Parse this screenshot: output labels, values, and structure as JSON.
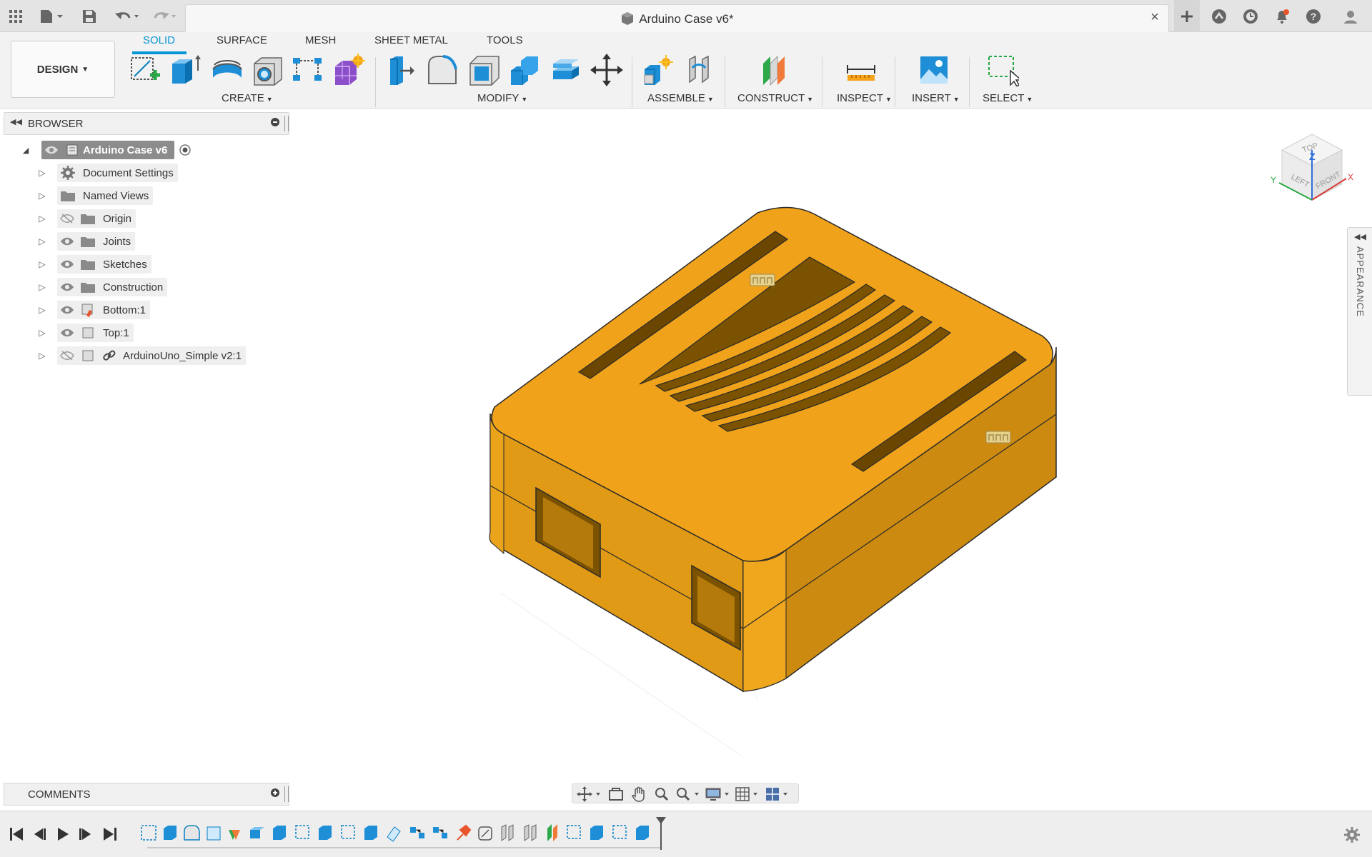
{
  "window": {
    "title": "Arduino Case v6*",
    "close_glyph": "×",
    "icons": [
      "apps-grid-icon",
      "file-menu-icon",
      "save-icon",
      "undo-icon",
      "redo-icon"
    ],
    "right_icons": [
      "new-tab-icon",
      "extensions-icon",
      "job-status-icon",
      "notifications-icon",
      "help-icon",
      "account-icon"
    ]
  },
  "toolbar": {
    "workspace": "DESIGN",
    "tabs": [
      "SOLID",
      "SURFACE",
      "MESH",
      "SHEET METAL",
      "TOOLS"
    ],
    "active_tab": "SOLID",
    "groups": {
      "create": "CREATE",
      "modify": "MODIFY",
      "assemble": "ASSEMBLE",
      "construct": "CONSTRUCT",
      "inspect": "INSPECT",
      "insert": "INSERT",
      "select": "SELECT"
    }
  },
  "browser": {
    "title": "BROWSER",
    "root": "Arduino Case v6",
    "items": [
      {
        "label": "Document Settings",
        "icon": "gear-icon"
      },
      {
        "label": "Named Views",
        "icon": "folder-icon"
      },
      {
        "label": "Origin",
        "icon": "folder-icon",
        "hidden": true
      },
      {
        "label": "Joints",
        "icon": "folder-icon"
      },
      {
        "label": "Sketches",
        "icon": "folder-icon"
      },
      {
        "label": "Construction",
        "icon": "folder-icon"
      },
      {
        "label": "Bottom:1",
        "icon": "component-icon"
      },
      {
        "label": "Top:1",
        "icon": "component-icon"
      },
      {
        "label": "ArduinoUno_Simple v2:1",
        "icon": "linked-component-icon",
        "hidden": true
      }
    ]
  },
  "comments": {
    "title": "COMMENTS"
  },
  "appearance_panel": {
    "label": "APPEARANCE"
  },
  "viewcube": {
    "faces": [
      "TOP",
      "LEFT",
      "FRONT"
    ],
    "axes": [
      "X",
      "Y",
      "Z"
    ]
  },
  "colors": {
    "accent": "#0696d7",
    "model": "#f0a31a",
    "model_dark": "#c98a10"
  }
}
